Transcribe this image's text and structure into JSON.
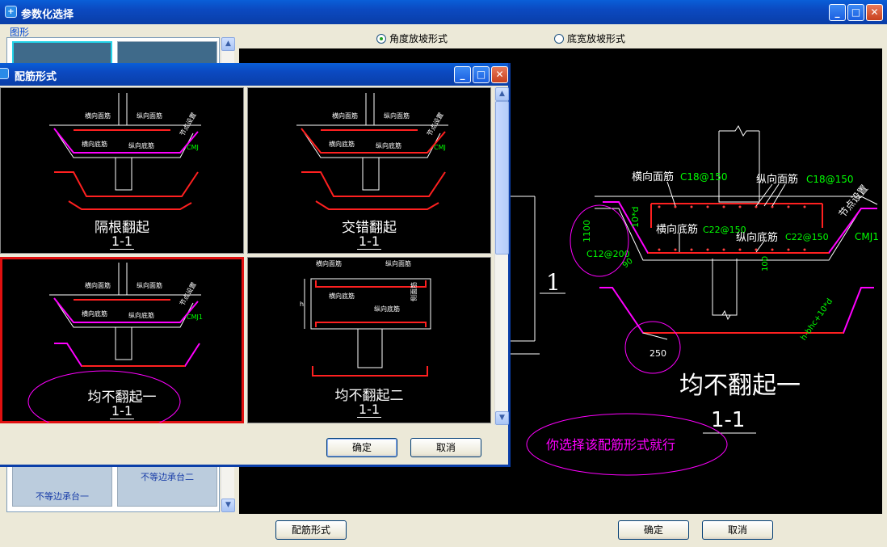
{
  "window": {
    "title": "参数化选择",
    "min": "_",
    "max": "□",
    "close": "✕"
  },
  "left_panel": {
    "group_label": "图形",
    "thumbs": [
      {
        "label": ""
      },
      {
        "label": ""
      },
      {
        "label": "不等边承台一"
      },
      {
        "label": "不等边承台二"
      }
    ]
  },
  "radio_group": [
    {
      "label": "角度放坡形式",
      "checked": true
    },
    {
      "label": "底宽放坡形式",
      "checked": false
    }
  ],
  "canvas": {
    "labels": {
      "top_bar": "横向面筋",
      "top_bar_spec": "C18@150",
      "long_top_bar": "纵向面筋",
      "long_top_bar_spec": "C18@150",
      "bottom_bar": "横向底筋",
      "bottom_bar_spec": "C22@150",
      "long_bottom_bar": "纵向底筋",
      "long_bottom_bar_spec": "C22@150",
      "side_spec": "C12@200",
      "dim_1100": "1100",
      "dim_10d": "10*d",
      "dim_100": "100",
      "angle_90": "90",
      "dim_250": "250",
      "cmj": "CMJ1",
      "node_setting": "节点设置",
      "slope_formula": "h-bhc+10*d",
      "one": "1",
      "main_title": "均不翻起一",
      "section": "1-1",
      "note": "你选择该配筋形式就行"
    }
  },
  "dialog": {
    "title": "配筋形式",
    "options": [
      {
        "title": "隔根翻起",
        "section": "1-1"
      },
      {
        "title": "交错翻起",
        "section": "1-1"
      },
      {
        "title": "均不翻起一",
        "section": "1-1"
      },
      {
        "title": "均不翻起二",
        "section": "1-1"
      }
    ],
    "mini_labels": {
      "top_h": "横向面筋",
      "top_v": "纵向面筋",
      "bot_h": "横向底筋",
      "bot_v": "纵向底筋",
      "tag": "MJ",
      "tag2": "DJ",
      "node": "节点设置",
      "cmj": "CMJ",
      "cmj1": "CMJ1",
      "h": "h",
      "edge": "侧面筋"
    },
    "ok": "确定",
    "cancel": "取消"
  },
  "bottom": {
    "rebar_form": "配筋形式",
    "ok": "确定",
    "cancel": "取消"
  },
  "colors": {
    "highlight": "#e01010",
    "green": "#00ff00",
    "magenta": "#ff00ff",
    "red": "#ff2020"
  }
}
